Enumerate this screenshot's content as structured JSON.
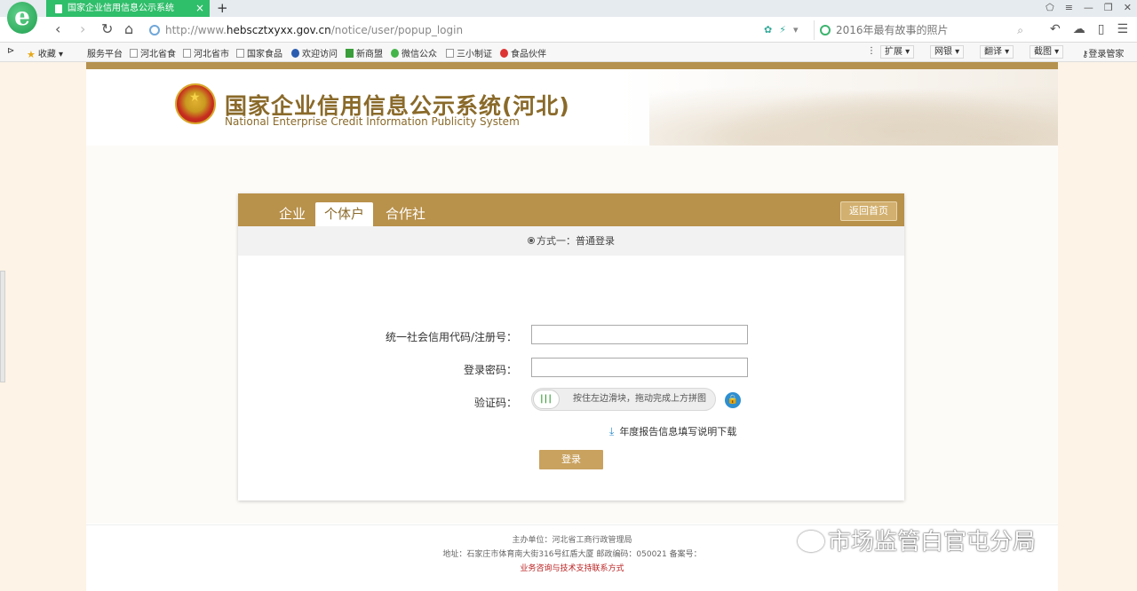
{
  "browser": {
    "tab_title": "国家企业信用信息公示系统",
    "tab_close": "×",
    "new_tab": "+",
    "url_prefix": "http://www.",
    "url_host": "hebscztxyxx.gov.cn",
    "url_path": "/notice/user/popup_login",
    "search_placeholder": "2016年最有故事的照片",
    "bookmarks": [
      "收藏",
      "服务平台",
      "河北省食",
      "河北省市",
      "国家食品",
      "欢迎访问",
      "新商盟",
      "微信公众",
      "三小制证",
      "食品伙伴"
    ],
    "tools": [
      "扩展",
      "网银",
      "翻译",
      "截图",
      "登录管家"
    ]
  },
  "header": {
    "title": "国家企业信用信息公示系统(河北)",
    "subtitle": "National Enterprise Credit Information Publicity System"
  },
  "login": {
    "tabs": [
      "企业",
      "个体户",
      "合作社"
    ],
    "active_tab": "个体户",
    "back_home": "返回首页",
    "mode_text": "方式一：普通登录",
    "code_label": "统一社会信用代码/注册号：",
    "password_label": "登录密码：",
    "captcha_label": "验证码：",
    "slider_text": "按住左边滑块，拖动完成上方拼图",
    "download_link": "年度报告信息填写说明下载",
    "submit": "登录"
  },
  "footer": {
    "sponsor": "主办单位：河北省工商行政管理局",
    "address": "地址：石家庄市体育南大街316号红盾大厦 邮政编码：050021 备案号：",
    "contact": "业务咨询与技术支持联系方式"
  },
  "watermark": "市场监管白官屯分局",
  "colors": {
    "accent": "#b8914b",
    "tab_green": "#2fbe6a",
    "title_brown": "#8a6a2a"
  }
}
